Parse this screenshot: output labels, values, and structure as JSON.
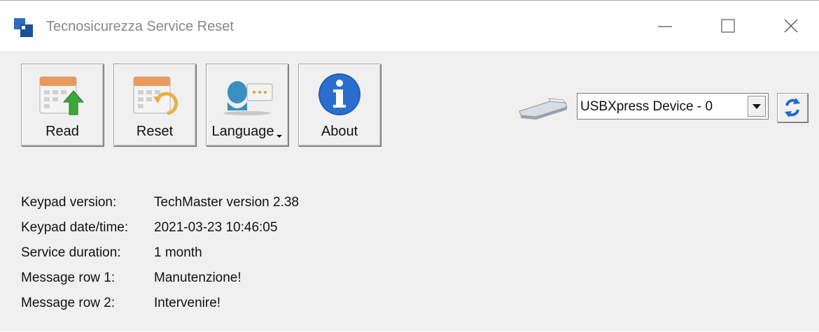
{
  "window": {
    "title": "Tecnosicurezza Service Reset"
  },
  "toolbar": {
    "buttons": [
      {
        "label": "Read",
        "icon": "calendar-read-icon"
      },
      {
        "label": "Reset",
        "icon": "calendar-reset-icon"
      },
      {
        "label": "Language",
        "icon": "language-icon"
      },
      {
        "label": "About",
        "icon": "info-icon"
      }
    ]
  },
  "device": {
    "selected": "USBXpress Device - 0",
    "icon": "usb-drive-icon",
    "refresh_icon": "refresh-icon"
  },
  "info": {
    "rows": [
      {
        "label": "Keypad version:",
        "value": "TechMaster version 2.38"
      },
      {
        "label": "Keypad date/time:",
        "value": "2021-03-23 10:46:05"
      },
      {
        "label": "Service duration:",
        "value": "1 month"
      },
      {
        "label": "Message row 1:",
        "value": "Manutenzione!"
      },
      {
        "label": "Message row 2:",
        "value": "Intervenire!"
      }
    ]
  },
  "colors": {
    "window_bg": "#f0f0f0",
    "titlebar_bg": "#ffffff",
    "accent_blue": "#1e5fb4"
  }
}
